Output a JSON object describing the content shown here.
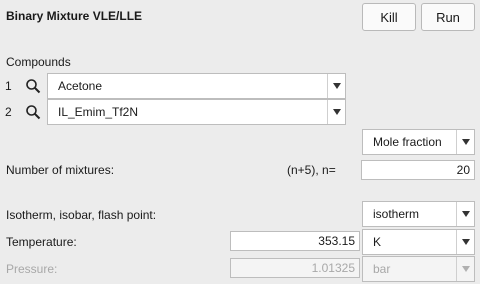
{
  "window": {
    "title": "Binary Mixture VLE/LLE"
  },
  "toolbar": {
    "kill_label": "Kill",
    "run_label": "Run"
  },
  "compounds": {
    "heading": "Compounds",
    "items": [
      {
        "index": "1",
        "name": "Acetone"
      },
      {
        "index": "2",
        "name": "IL_Emim_Tf2N"
      }
    ]
  },
  "composition": {
    "unit": "Mole fraction"
  },
  "mixtures": {
    "label": "Number of mixtures:",
    "hint": "(n+5), n=",
    "value": "20"
  },
  "condition": {
    "label": "Isotherm, isobar, flash point:",
    "value": "isotherm"
  },
  "temperature": {
    "label": "Temperature:",
    "value": "353.15",
    "unit": "K"
  },
  "pressure": {
    "label": "Pressure:",
    "value": "1.01325",
    "unit": "bar"
  }
}
